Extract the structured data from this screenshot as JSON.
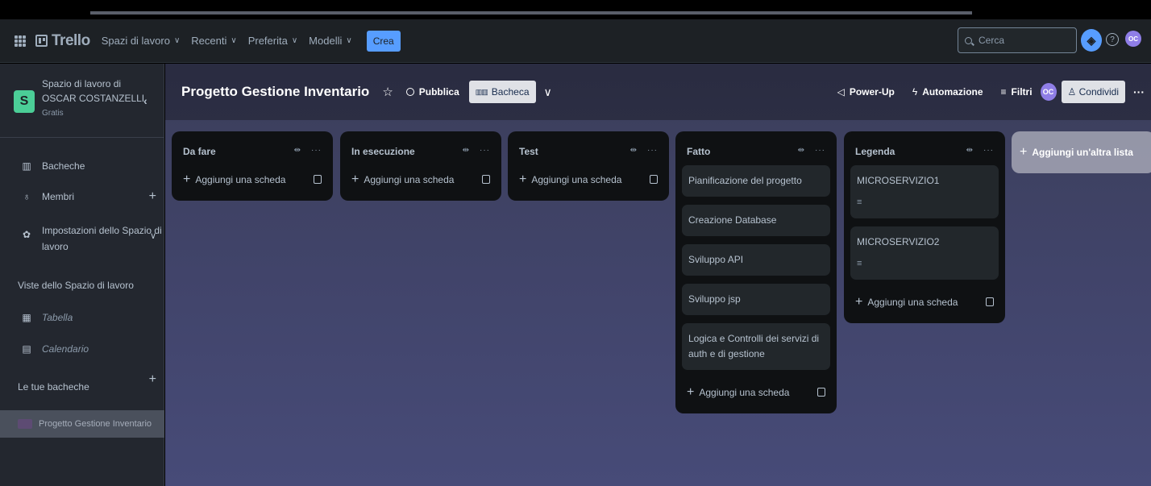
{
  "topnav": {
    "logo": "Trello",
    "items": [
      {
        "label": "Spazi di lavoro"
      },
      {
        "label": "Recenti"
      },
      {
        "label": "Preferita"
      },
      {
        "label": "Modelli"
      }
    ],
    "create_label": "Crea",
    "search_placeholder": "Cerca",
    "avatar_initials": "OC",
    "accent_color": "#579dff"
  },
  "sidebar": {
    "workspace_line1": "Spazio di lavoro di",
    "workspace_line2": "OSCAR COSTANZELLI",
    "workspace_plan": "Gratis",
    "workspace_initial": "S",
    "items": [
      {
        "label": "Bacheche",
        "icon": "board-icon"
      },
      {
        "label": "Membri",
        "icon": "members-icon"
      },
      {
        "label": "Impostazioni dello Spazio di",
        "label2": "lavoro",
        "icon": "gear-icon"
      }
    ],
    "views_heading": "Viste dello Spazio di lavoro",
    "views": [
      {
        "label": "Tabella",
        "icon": "table-icon"
      },
      {
        "label": "Calendario",
        "icon": "calendar-icon"
      }
    ],
    "boards_heading": "Le tue bacheche",
    "boards": [
      {
        "label": "Progetto Gestione Inventario"
      }
    ]
  },
  "board": {
    "title": "Progetto Gestione Inventario",
    "visibility": "Pubblica",
    "view_label": "Bacheca",
    "actions": {
      "powerup": "Power-Up",
      "automation": "Automazione",
      "filters": "Filtri",
      "share": "Condividi"
    },
    "member_initials": "OC",
    "add_list_label": "Aggiungi un'altra lista",
    "add_card_label": "Aggiungi una scheda"
  },
  "lists": [
    {
      "title": "Da fare",
      "cards": []
    },
    {
      "title": "In esecuzione",
      "cards": []
    },
    {
      "title": "Test",
      "cards": []
    },
    {
      "title": "Fatto",
      "cards": [
        {
          "text": "Pianificazione del progetto"
        },
        {
          "text": "Creazione Database"
        },
        {
          "text": "Sviluppo API"
        },
        {
          "text": "Sviluppo jsp"
        },
        {
          "text": "Logica e Controlli dei servizi di auth e di gestione"
        }
      ]
    },
    {
      "title": "Legenda",
      "cards": [
        {
          "text": "MICROSERVIZIO1",
          "has_description": true
        },
        {
          "text": "MICROSERVIZIO2",
          "has_description": true
        }
      ]
    }
  ]
}
